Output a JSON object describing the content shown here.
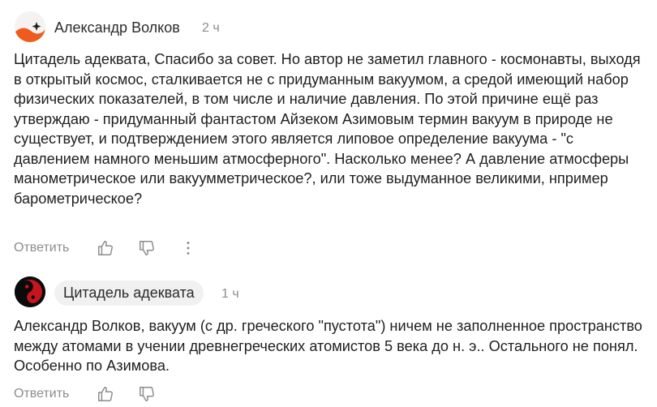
{
  "comments": [
    {
      "author": "Александр Волков",
      "time": "2 ч",
      "text": "Цитадель адеквата, Спасибо за совет. Но автор не заметил главного - космонавты, выходя в открытый космос, сталкивается не с придуманным вакуумом, а средой имеющий набор физических показателей, в том числе и наличие давления. По этой причине ещё раз утверждаю - придуманный фантастом Айзеком Азимовым термин вакуум в природе не существует, и подтверждением этого является липовое определение вакуума - \"с давлением намного меньшим атмосферного\". Насколько менее? А давление атмосферы манометрическое или вакуумметрическое?, или тоже выдуманное великими, нпример барометрическое?",
      "reply_label": "Ответить",
      "avatar_icon": "orange-wave-star-avatar"
    },
    {
      "author": "Цитадель адеквата",
      "time": "1 ч",
      "text": "Александр Волков, вакуум (с др. греческого \"пустота\") ничем не заполненное пространство между атомами в учении древнегреческих атомистов 5 века до н. э.. Остального не понял. Особенно по Азимова.",
      "reply_label": "Ответить",
      "avatar_icon": "yin-yang-avatar"
    }
  ],
  "icons": {
    "like": "thumbs-up-icon",
    "dislike": "thumbs-down-icon",
    "more": "more-vertical-icon"
  },
  "colors": {
    "text": "#1f1f1f",
    "muted": "#8c8c8c",
    "author_chip_bg": "#f1f1f1",
    "avatar_orange": "#f05a1e"
  }
}
